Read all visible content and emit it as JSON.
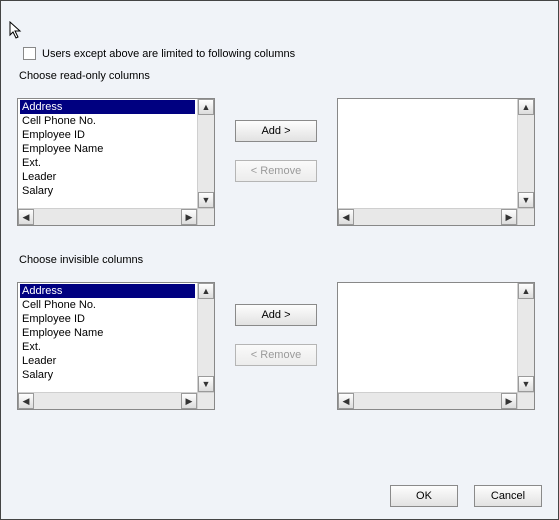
{
  "checkbox_label": "Users except above are limited to following columns",
  "checkbox_checked": false,
  "readonly": {
    "label": "Choose read-only columns",
    "left_items": [
      "Address",
      "Cell Phone No.",
      "Employee ID",
      "Employee Name",
      "Ext.",
      "Leader",
      "Salary"
    ],
    "left_selected": "Address",
    "right_items": [],
    "add_label": "Add >",
    "remove_label": "< Remove"
  },
  "invisible": {
    "label": "Choose invisible columns",
    "left_items": [
      "Address",
      "Cell Phone No.",
      "Employee ID",
      "Employee Name",
      "Ext.",
      "Leader",
      "Salary"
    ],
    "left_selected": "Address",
    "right_items": [],
    "add_label": "Add >",
    "remove_label": "< Remove"
  },
  "footer": {
    "ok": "OK",
    "cancel": "Cancel"
  },
  "arrows": {
    "up": "▲",
    "down": "▼",
    "left": "◀",
    "right": "▶"
  }
}
